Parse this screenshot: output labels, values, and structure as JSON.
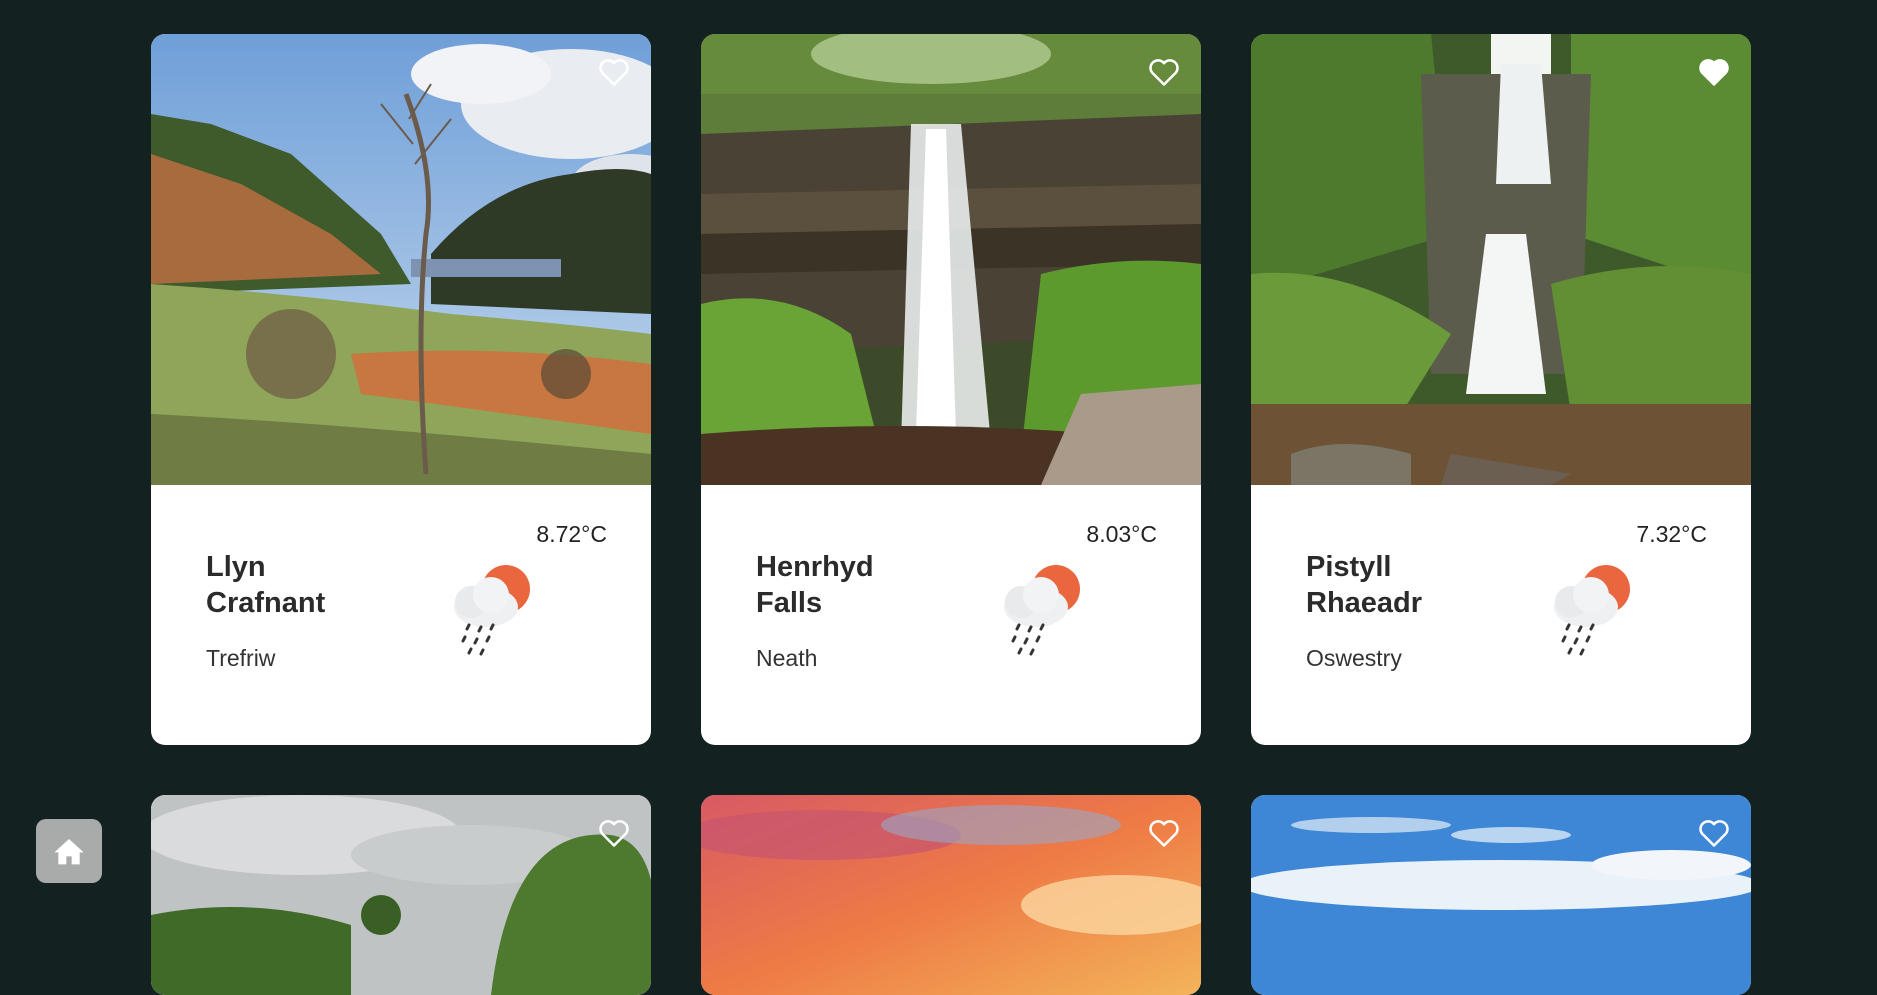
{
  "cards": [
    {
      "name_line1": "Llyn",
      "name_line2": "Crafnant",
      "town": "Trefriw",
      "temp": "8.72°C",
      "weather_icon": "sun-behind-rain-cloud",
      "favourite": false
    },
    {
      "name_line1": "Henrhyd",
      "name_line2": "Falls",
      "town": "Neath",
      "temp": "8.03°C",
      "weather_icon": "sun-behind-rain-cloud",
      "favourite": false
    },
    {
      "name_line1": "Pistyll",
      "name_line2": "Rhaeadr",
      "town": "Oswestry",
      "temp": "7.32°C",
      "weather_icon": "sun-behind-rain-cloud",
      "favourite": true
    },
    {
      "favourite": false
    },
    {
      "favourite": false
    },
    {
      "favourite": false
    }
  ],
  "icons": {
    "favourite": "heart-icon",
    "home": "home-icon"
  },
  "colors": {
    "background": "#132220",
    "card": "#ffffff",
    "home_button": "#a9abaa",
    "sun": "#e9663f"
  }
}
